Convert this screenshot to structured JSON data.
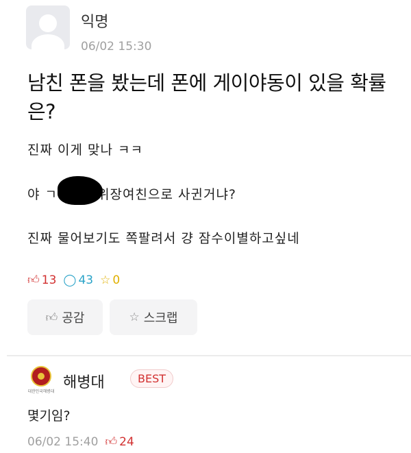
{
  "post": {
    "author": "익명",
    "time": "06/02 15:30",
    "title": "남친 폰을 봤는데 폰에 게이야동이 있을 확률은?",
    "lines": [
      "진짜 이게 맞나 ㅋㅋ",
      "야 ㄱ          아 나 위장여친으로 사귄거냐?",
      "진짜 물어보기도 쪽팔려서 걍 잠수이별하고싶네"
    ],
    "stats": {
      "likes": "13",
      "comments": "43",
      "scraps": "0"
    },
    "buttons": {
      "like": "공감",
      "scrap": "스크랩"
    }
  },
  "comment": {
    "author": "해병대",
    "badge": "BEST",
    "logo_text": "대한민국해병대",
    "text": "몇기임?",
    "time": "06/02 15:40",
    "likes": "24"
  },
  "icons": {
    "like": "thumbs-up-icon",
    "comment": "speech-bubble-icon",
    "scrap": "star-icon"
  },
  "colors": {
    "like": "#d23030",
    "comment": "#2aa3c8",
    "scrap": "#e0b000"
  }
}
